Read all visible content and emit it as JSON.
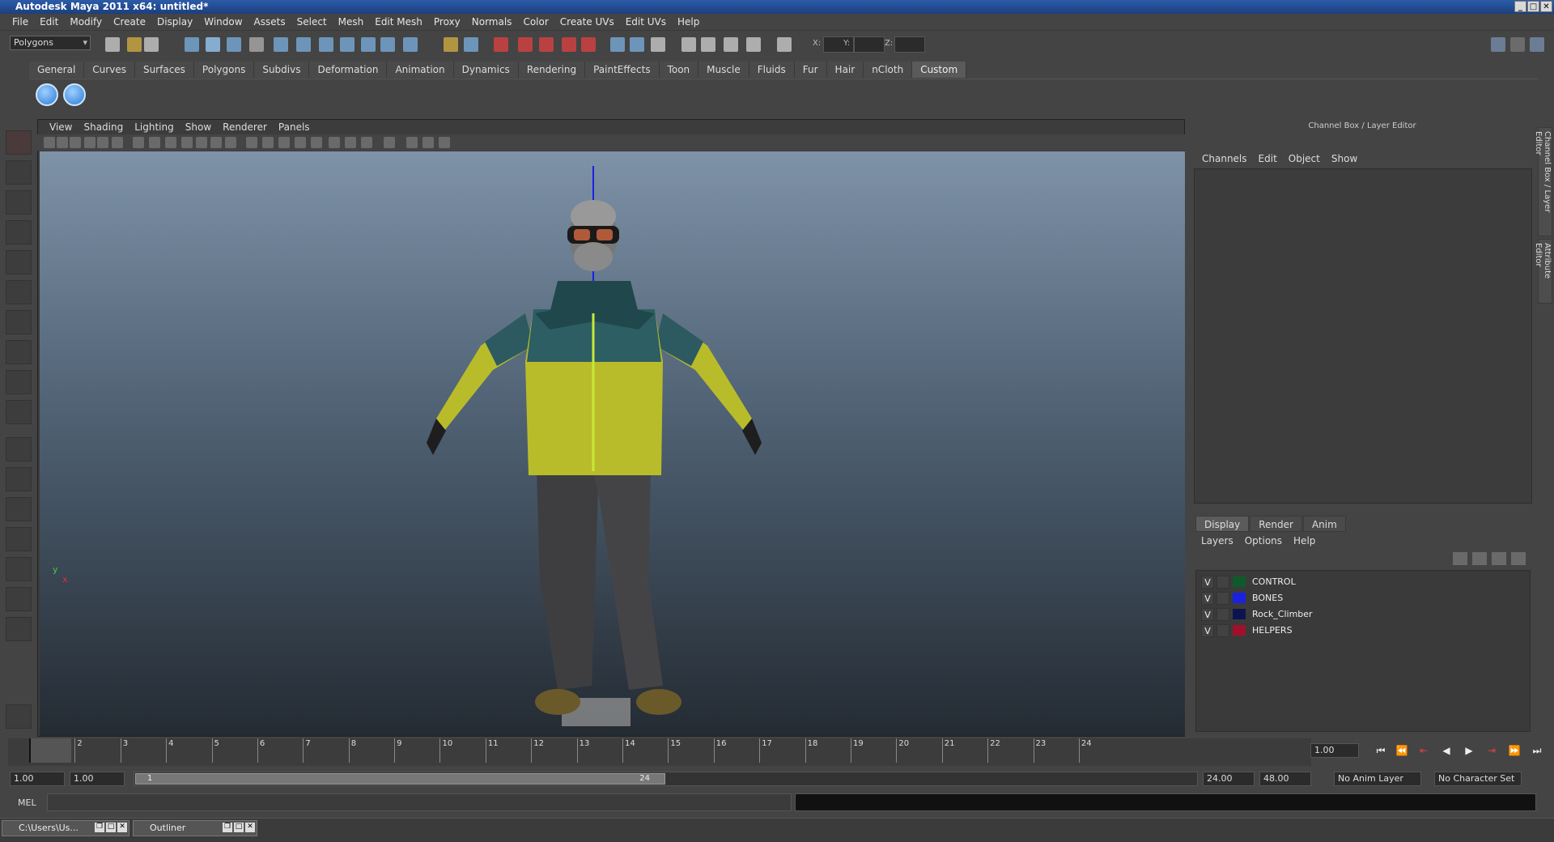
{
  "window": {
    "title": "Autodesk Maya 2011 x64: untitled*"
  },
  "menu": [
    "File",
    "Edit",
    "Modify",
    "Create",
    "Display",
    "Window",
    "Assets",
    "Select",
    "Mesh",
    "Edit Mesh",
    "Proxy",
    "Normals",
    "Color",
    "Create UVs",
    "Edit UVs",
    "Help"
  ],
  "status": {
    "mode": "Polygons",
    "x_label": "X:",
    "y_label": "Y:",
    "z_label": "Z:"
  },
  "shelf": {
    "tabs": [
      "General",
      "Curves",
      "Surfaces",
      "Polygons",
      "Subdivs",
      "Deformation",
      "Animation",
      "Dynamics",
      "Rendering",
      "PaintEffects",
      "Toon",
      "Muscle",
      "Fluids",
      "Fur",
      "Hair",
      "nCloth",
      "Custom"
    ],
    "active": "Custom"
  },
  "viewport": {
    "menu": [
      "View",
      "Shading",
      "Lighting",
      "Show",
      "Renderer",
      "Panels"
    ],
    "axis_y": "y",
    "axis_x": "x"
  },
  "channelbox": {
    "title": "Channel Box / Layer Editor",
    "menu": [
      "Channels",
      "Edit",
      "Object",
      "Show"
    ]
  },
  "sidetabs": [
    "Channel Box / Layer Editor",
    "Attribute Editor"
  ],
  "layers": {
    "tabs": [
      "Display",
      "Render",
      "Anim"
    ],
    "menu": [
      "Layers",
      "Options",
      "Help"
    ],
    "items": [
      {
        "v": "V",
        "name": "CONTROL",
        "color": "#0f5a2a"
      },
      {
        "v": "V",
        "name": "BONES",
        "color": "#1a22e0"
      },
      {
        "v": "V",
        "name": "Rock_Climber",
        "color": "#0c1450"
      },
      {
        "v": "V",
        "name": "HELPERS",
        "color": "#a0102a"
      }
    ]
  },
  "timeline": {
    "ticks": [
      "1",
      "2",
      "3",
      "4",
      "5",
      "6",
      "7",
      "8",
      "9",
      "10",
      "11",
      "12",
      "13",
      "14",
      "15",
      "16",
      "17",
      "18",
      "19",
      "20",
      "21",
      "22",
      "23",
      "24"
    ],
    "current_frame": "1.00"
  },
  "range": {
    "start": "1.00",
    "start2": "1.00",
    "slider_start": "1",
    "slider_end": "24",
    "end": "24.00",
    "end2": "48.00",
    "anim_layer": "No Anim Layer",
    "char_set": "No Character Set"
  },
  "command": {
    "label": "MEL"
  },
  "taskbar": [
    {
      "label": "C:\\Users\\Us..."
    },
    {
      "label": "Outliner"
    }
  ]
}
